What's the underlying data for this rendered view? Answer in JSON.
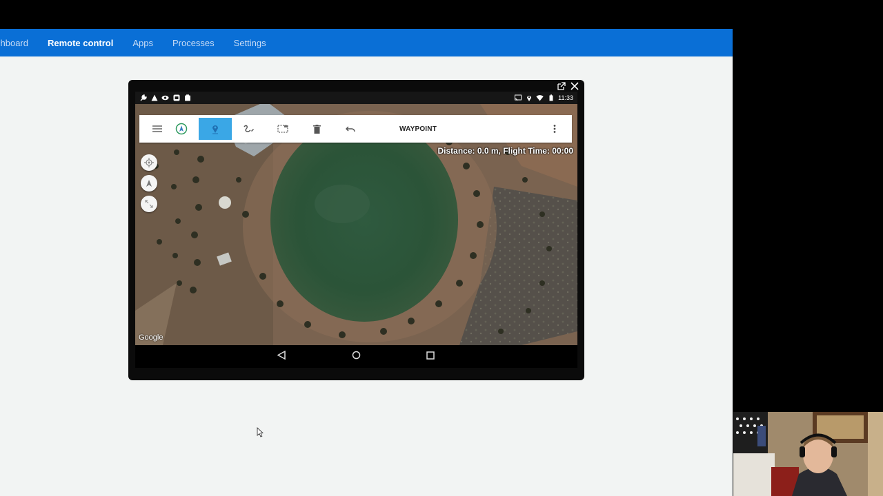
{
  "navbar": {
    "items": [
      {
        "label": "Dashboard",
        "active": false
      },
      {
        "label": "Remote control",
        "active": true
      },
      {
        "label": "Apps",
        "active": false
      },
      {
        "label": "Processes",
        "active": false
      },
      {
        "label": "Settings",
        "active": false
      }
    ],
    "first_item_visible_text": "shboard"
  },
  "device_window": {
    "controls": [
      {
        "icon": "popout-icon",
        "glyph": "⧉"
      },
      {
        "icon": "close-icon",
        "glyph": "✕"
      }
    ],
    "statusbar": {
      "left_icons": [
        "wrench-icon",
        "warning-icon",
        "eye-icon",
        "app-icon",
        "clipboard-icon"
      ],
      "right_icons": [
        "cast-icon",
        "location-icon",
        "wifi-icon",
        "battery-icon"
      ],
      "time": "11:33"
    },
    "toolbar": {
      "title": "WAYPOINT",
      "buttons": [
        "menu-icon",
        "compass-icon",
        "waypoint-icon",
        "draw-path-icon",
        "select-area-icon",
        "delete-icon",
        "undo-icon"
      ],
      "selected": "waypoint-icon"
    },
    "map": {
      "info": "Distance: 0.0 m, Flight Time: 00:00",
      "attribution": "Google",
      "controls": [
        "my-location-icon",
        "navigate-icon",
        "fit-bounds-icon"
      ]
    },
    "android_nav": [
      "back-icon",
      "home-icon",
      "recents-icon"
    ]
  },
  "colors": {
    "navbar": "#0a6fd6",
    "toolbar_selected": "#3aa7e6",
    "page_bg": "#f2f4f3"
  }
}
